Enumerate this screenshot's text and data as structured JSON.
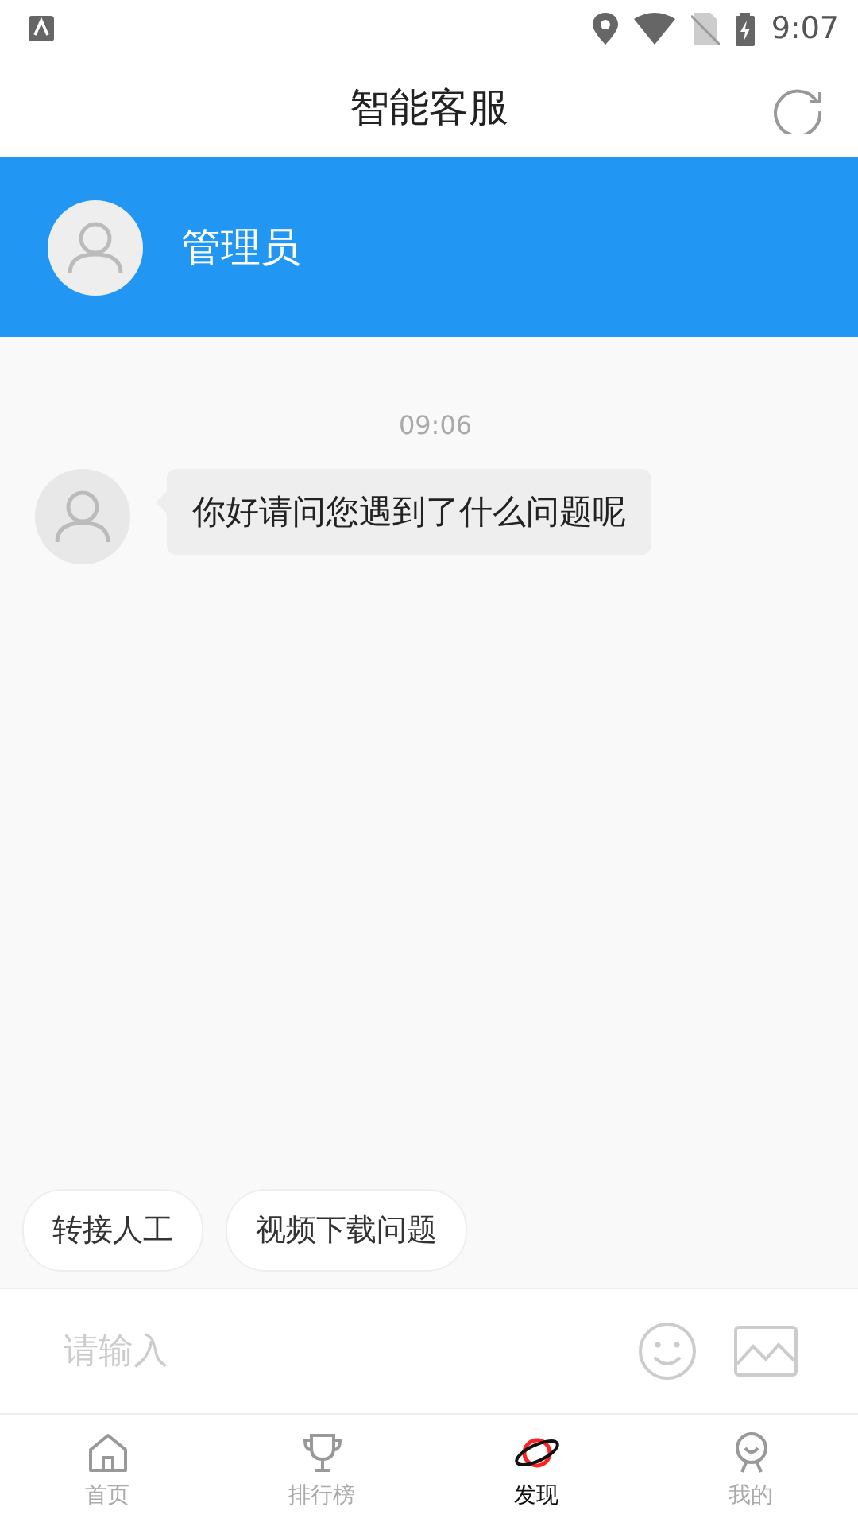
{
  "status_bar": {
    "time": "9:07"
  },
  "header": {
    "title": "智能客服"
  },
  "agent": {
    "name": "管理员"
  },
  "chat": {
    "timestamp": "09:06",
    "messages": [
      {
        "text": "你好请问您遇到了什么问题呢"
      }
    ]
  },
  "quick_replies": [
    "转接人工",
    "视频下载问题"
  ],
  "input": {
    "placeholder": "请输入"
  },
  "tabs": [
    {
      "label": "首页",
      "kind": "home",
      "selected": false
    },
    {
      "label": "排行榜",
      "kind": "trophy",
      "selected": false
    },
    {
      "label": "发现",
      "kind": "planet",
      "selected": true
    },
    {
      "label": "我的",
      "kind": "person",
      "selected": false
    }
  ]
}
